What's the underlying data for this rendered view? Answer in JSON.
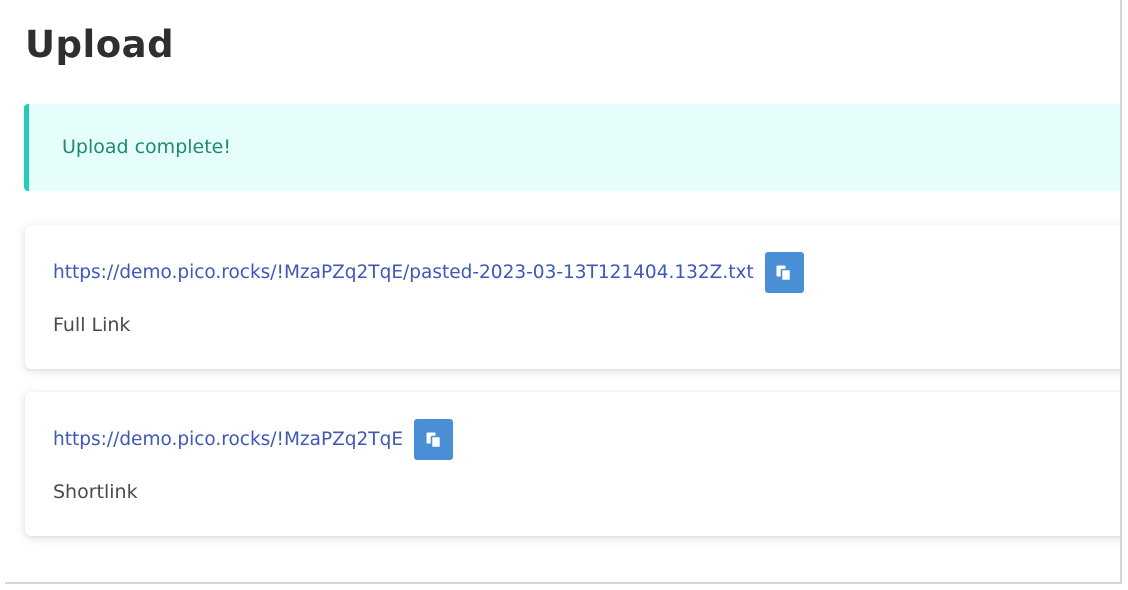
{
  "page": {
    "title": "Upload"
  },
  "alert": {
    "message": "Upload complete!"
  },
  "links": [
    {
      "url": "https://demo.pico.rocks/!MzaPZq2TqE/pasted-2023-03-13T121404.132Z.txt",
      "label": "Full Link",
      "icon": "copy-icon"
    },
    {
      "url": "https://demo.pico.rocks/!MzaPZq2TqE",
      "label": "Shortlink",
      "icon": "copy-icon"
    }
  ],
  "colors": {
    "alert_background": "#e6fefb",
    "alert_border": "#22cdb3",
    "alert_text": "#1d8a72",
    "link": "#3e58b8",
    "copy_button": "#4a8fd6"
  }
}
